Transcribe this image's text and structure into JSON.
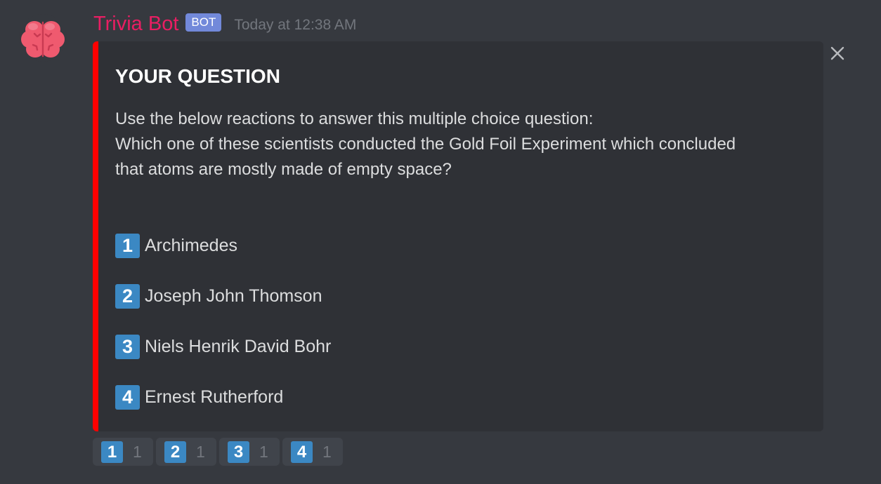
{
  "message": {
    "username": "Trivia Bot",
    "bot_tag": "BOT",
    "timestamp": "Today at 12:38 AM",
    "avatar_icon": "brain-icon",
    "close_icon": "close-icon"
  },
  "colors": {
    "username": "#e91e63",
    "bot_tag": "#7289da",
    "embed_accent": "#ff0000",
    "keycap": "#3b88c3",
    "avatar": "#ef5a6f"
  },
  "embed": {
    "title": "YOUR QUESTION",
    "description_lines": [
      "Use the below reactions to answer this multiple choice question:",
      "Which one of these scientists conducted the Gold Foil Experiment which concluded",
      "that atoms are mostly made of empty space?"
    ],
    "options": [
      {
        "key": "1",
        "text": "Archimedes"
      },
      {
        "key": "2",
        "text": "Joseph John Thomson"
      },
      {
        "key": "3",
        "text": "Niels Henrik David Bohr"
      },
      {
        "key": "4",
        "text": "Ernest Rutherford"
      }
    ]
  },
  "reactions": [
    {
      "emoji": "1",
      "count": "1"
    },
    {
      "emoji": "2",
      "count": "1"
    },
    {
      "emoji": "3",
      "count": "1"
    },
    {
      "emoji": "4",
      "count": "1"
    }
  ]
}
